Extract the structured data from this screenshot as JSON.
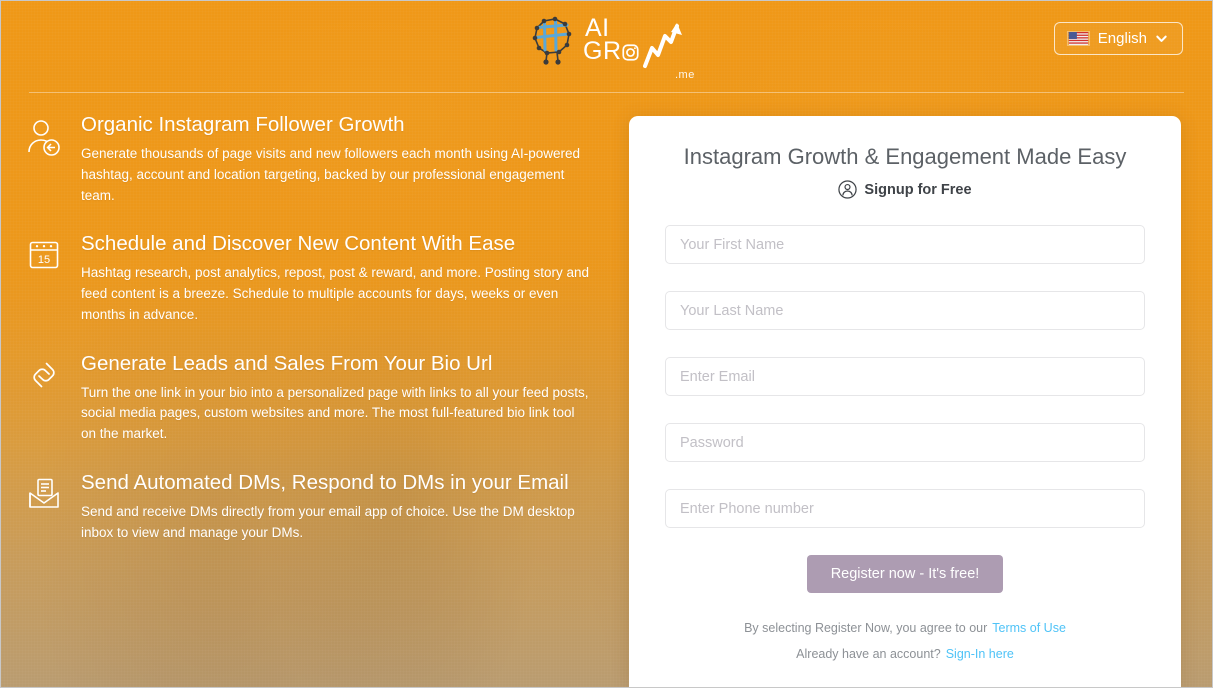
{
  "header": {
    "logo": {
      "line1": "AI",
      "line2": "GR",
      "line2_suffix": "W",
      "tld": ".me",
      "brain_icon": "brain-network-icon",
      "instagram_icon": "instagram-icon",
      "growth_arrow_icon": "growth-arrow-icon"
    },
    "language": {
      "label": "English",
      "flag_icon": "us-flag-icon",
      "chevron_icon": "chevron-down-icon"
    }
  },
  "features": [
    {
      "icon": "user-follower-icon",
      "title": "Organic Instagram Follower Growth",
      "desc": "Generate thousands of page visits and new followers each month using AI-powered hashtag, account and location targeting, backed by our professional engagement team."
    },
    {
      "icon": "calendar-icon",
      "icon_day": "15",
      "title": "Schedule and Discover New Content With Ease",
      "desc": "Hashtag research, post analytics, repost, post & reward, and more. Posting story and feed content is a breeze. Schedule to multiple accounts for days, weeks or even months in advance."
    },
    {
      "icon": "link-chain-icon",
      "title": "Generate Leads and Sales From Your Bio Url",
      "desc": "Turn the one link in your bio into a personalized page with links to all your feed posts, social media pages, custom websites and more. The most full-featured bio link tool on the market."
    },
    {
      "icon": "open-envelope-icon",
      "title": "Send Automated DMs, Respond to DMs in your Email",
      "desc": "Send and receive DMs directly from your email app of choice. Use the DM desktop inbox to view and manage your DMs."
    }
  ],
  "signup": {
    "title": "Instagram Growth & Engagement Made Easy",
    "subtitle": "Signup for Free",
    "subtitle_icon": "user-circle-icon",
    "fields": {
      "first_name": {
        "placeholder": "Your First Name",
        "value": ""
      },
      "last_name": {
        "placeholder": "Your Last Name",
        "value": ""
      },
      "email": {
        "placeholder": "Enter Email",
        "value": ""
      },
      "password": {
        "placeholder": "Password",
        "value": ""
      },
      "phone": {
        "placeholder": "Enter Phone number",
        "value": ""
      }
    },
    "register_button": "Register now - It's free!",
    "terms_text": "By selecting Register Now, you agree to our",
    "terms_link": "Terms of Use",
    "account_text": "Already have an account?",
    "signin_link": "Sign-In here"
  },
  "colors": {
    "brand_orange": "#ec991d",
    "card_white": "#ffffff",
    "button_mauve": "#ad9cb2",
    "link_blue": "#4fc3f7",
    "title_gray": "#5c6166"
  }
}
